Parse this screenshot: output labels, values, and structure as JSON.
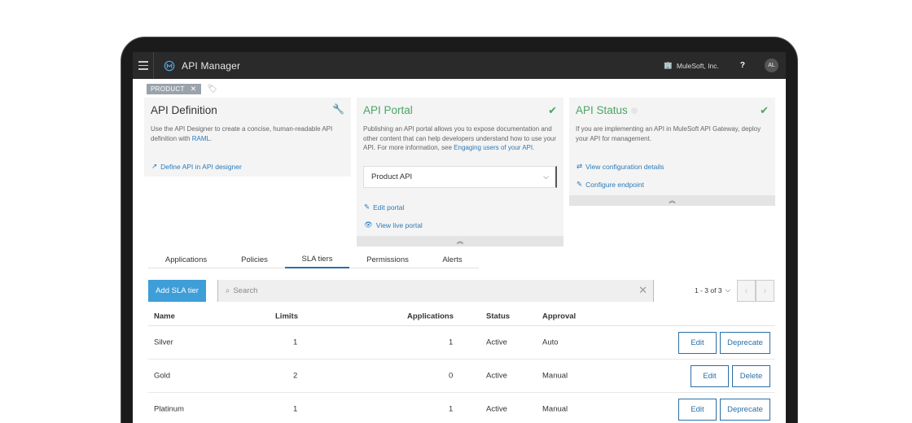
{
  "topbar": {
    "title": "API Manager",
    "org": "MuleSoft, Inc.",
    "help": "?",
    "avatar": "AL"
  },
  "tag": {
    "label": "PRODUCT",
    "close": "✕"
  },
  "cards": {
    "definition": {
      "title": "API Definition",
      "desc_prefix": "Use the API Designer to create a concise, human-readable API definition with ",
      "desc_link": "RAML",
      "desc_suffix": ".",
      "action": "Define API in API designer"
    },
    "portal": {
      "title": "API Portal",
      "desc_prefix": "Publishing an API portal allows you to expose documentation and other content that can help developers understand how to use your API. For more information, see ",
      "desc_link": "Engaging users of your API",
      "desc_suffix": ".",
      "select_value": "Product API",
      "action_edit": "Edit portal",
      "action_view": "View live portal"
    },
    "status": {
      "title": "API Status",
      "desc": "If you are implementing an API in MuleSoft API Gateway, deploy your API for management.",
      "action_config": "View configuration details",
      "action_endpoint": "Configure endpoint"
    }
  },
  "tabs": [
    {
      "label": "Applications"
    },
    {
      "label": "Policies"
    },
    {
      "label": "SLA tiers"
    },
    {
      "label": "Permissions"
    },
    {
      "label": "Alerts"
    }
  ],
  "toolbar": {
    "add_label": "Add SLA tier",
    "search_placeholder": "Search",
    "pager_text": "1 - 3 of 3"
  },
  "table": {
    "headers": {
      "name": "Name",
      "limits": "Limits",
      "applications": "Applications",
      "status": "Status",
      "approval": "Approval"
    },
    "rows": [
      {
        "name": "Silver",
        "limits": "1",
        "applications": "1",
        "status": "Active",
        "approval": "Auto",
        "edit": "Edit",
        "action": "Deprecate"
      },
      {
        "name": "Gold",
        "limits": "2",
        "applications": "0",
        "status": "Active",
        "approval": "Manual",
        "edit": "Edit",
        "action": "Delete"
      },
      {
        "name": "Platinum",
        "limits": "1",
        "applications": "1",
        "status": "Active",
        "approval": "Manual",
        "edit": "Edit",
        "action": "Deprecate"
      }
    ]
  },
  "colors": {
    "accent": "#3e9ed8",
    "link": "#2b7bb9",
    "success": "#4aa564",
    "topbar": "#2a2a2a"
  }
}
